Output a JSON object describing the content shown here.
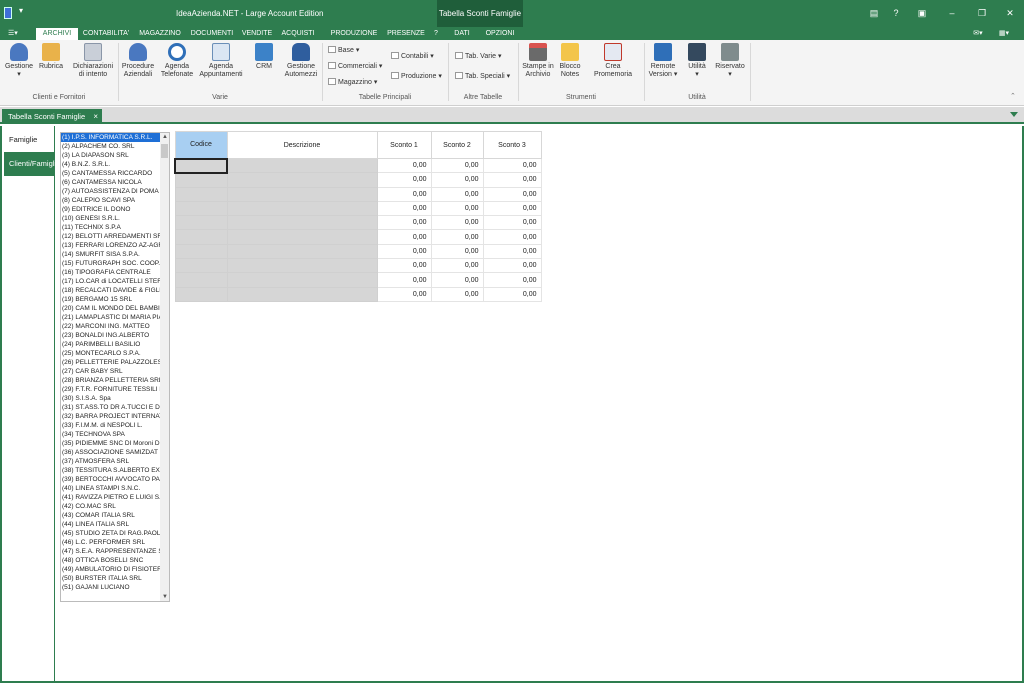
{
  "titlebar": {
    "app_title": "IdeaAzienda.NET - Large Account Edition",
    "context_title": "Tabella Sconti Famiglie",
    "help": "?"
  },
  "tabs": [
    {
      "label": "ARCHIVI",
      "active": true
    },
    {
      "label": "CONTABILITA'"
    },
    {
      "label": "MAGAZZINO"
    },
    {
      "label": "DOCUMENTI"
    },
    {
      "label": "VENDITE"
    },
    {
      "label": "ACQUISTI"
    },
    {
      "label": "PRODUZIONE"
    },
    {
      "label": "PRESENZE"
    },
    {
      "label": "?"
    },
    {
      "label": "DATI"
    },
    {
      "label": "OPZIONI"
    }
  ],
  "ribbon": {
    "buttons": {
      "gestione": "Gestione",
      "rubrica": "Rubrica",
      "dichiarazioni": "Dichiarazioni",
      "dichiarazioni2": "di intento",
      "procedure": "Procedure",
      "procedure2": "Aziendali",
      "agenda_tel": "Agenda",
      "agenda_tel2": "Telefonate",
      "agenda_app": "Agenda",
      "agenda_app2": "Appuntamenti",
      "crm": "CRM",
      "gestione_auto": "Gestione",
      "gestione_auto2": "Automezzi",
      "base": "Base",
      "commerciali": "Commerciali",
      "magazzino": "Magazzino",
      "contabili": "Contabili",
      "produzione": "Produzione",
      "tab_varie": "Tab. Varie",
      "tab_speciali": "Tab. Speciali",
      "stampe": "Stampe in",
      "stampe2": "Archivio",
      "blocco": "Blocco",
      "blocco2": "Notes",
      "promemoria": "Crea Promemoria",
      "remote": "Remote",
      "remote2": "Version",
      "utilita": "Utilità",
      "riservato": "Riservato"
    },
    "groups": {
      "clienti": "Clienti e Fornitori",
      "varie": "Varie",
      "tabelle_principali": "Tabelle Principali",
      "altre_tabelle": "Altre Tabelle",
      "strumenti": "Strumenti",
      "utilita": "Utilità"
    }
  },
  "doctab": {
    "label": "Tabella Sconti Famiglie",
    "close": "×"
  },
  "leftnav": {
    "famiglie": "Famiglie",
    "clienti": "Clienti/Famiglie"
  },
  "clients": [
    "(1) I.P.S. INFORMATICA S.R.L.",
    "(2) ALPACHEM CO. SRL",
    "(3) LA DIAPASON SRL",
    "(4) B.N.Z. S.R.L.",
    "(5) CANTAMESSA RICCARDO",
    "(6) CANTAMESSA NICOLA",
    "(7) AUTOASSISTENZA DI POMA L",
    "(8) CALEPIO SCAVI SPA",
    "(9) EDITRICE IL DONO",
    "(10) GENESI S.R.L.",
    "(11) TECHNIX S.P.A",
    "(12) BELOTTI ARREDAMENTI SRL",
    "(13) FERRARI LORENZO AZ-AGRI",
    "(14) SMURFIT SISA S.P.A.",
    "(15) FUTURGRAPH SOC. COOP. A",
    "(16) TIPOGRAFIA CENTRALE",
    "(17) LO.CAR di LOCATELLI STEFA",
    "(18) RECALCATI DAVIDE & FIGLIO",
    "(19) BERGAMO 15 SRL",
    "(20) CAM IL MONDO DEL BAMBIN",
    "(21) LAMAPLASTIC DI MARIA PIA",
    "(22) MARCONI ING. MATTEO",
    "(23) BONALDI ING.ALBERTO",
    "(24) PARIMBELLI BASILIO",
    "(25) MONTECARLO S.P.A.",
    "(26) PELLETTERIE PALAZZOLESI S",
    "(27) CAR BABY SRL",
    "(28) BRIANZA PELLETTERIA SRL",
    "(29) F.T.R. FORNITURE TESSILI F",
    "(30) S.I.S.A. Spa",
    "(31) ST.ASS.TO DR A.TUCCI E DR",
    "(32) BARRA PROJECT INTERNATI",
    "(33) F.I.M.M. di NESPOLI L.",
    "(34) TECHNOVA SPA",
    "(35) PIDIEMME SNC DI Moroni D.",
    "(36) ASSOCIAZIONE SAMIZDAT",
    "(37) ATMOSFERA SRL",
    "(38) TESSITURA S.ALBERTO EXPO",
    "(39) BERTOCCHI AVVOCATO PAO",
    "(40) LINEA STAMPI S.N.C.",
    "(41) RAVIZZA PIETRO E LUIGI S.N",
    "(42) CO.MAC SRL",
    "(43) COMAR ITALIA SRL",
    "(44) LINEA ITALIA SRL",
    "(45) STUDIO ZETA DI RAG.PAOLA",
    "(46) L.C. PERFORMER SRL",
    "(47) S.E.A. RAPPRESENTANZE SN",
    "(48) OTTICA BOSELLI SNC",
    "(49) AMBULATORIO DI FISIOTER",
    "(50) BURSTER ITALIA SRL",
    "(51) GAJANI LUCIANO"
  ],
  "grid": {
    "columns": [
      "Codice",
      "Descrizione",
      "Sconto 1",
      "Sconto 2",
      "Sconto 3"
    ],
    "rows": [
      [
        "",
        "",
        "0,00",
        "0,00",
        "0,00"
      ],
      [
        "",
        "",
        "0,00",
        "0,00",
        "0,00"
      ],
      [
        "",
        "",
        "0,00",
        "0,00",
        "0,00"
      ],
      [
        "",
        "",
        "0,00",
        "0,00",
        "0,00"
      ],
      [
        "",
        "",
        "0,00",
        "0,00",
        "0,00"
      ],
      [
        "",
        "",
        "0,00",
        "0,00",
        "0,00"
      ],
      [
        "",
        "",
        "0,00",
        "0,00",
        "0,00"
      ],
      [
        "",
        "",
        "0,00",
        "0,00",
        "0,00"
      ],
      [
        "",
        "",
        "0,00",
        "0,00",
        "0,00"
      ],
      [
        "",
        "",
        "0,00",
        "0,00",
        "0,00"
      ]
    ]
  },
  "colors": {
    "accent": "#2e7d4f",
    "selection": "#1e6fd6",
    "header_highlight": "#a8cff2"
  }
}
